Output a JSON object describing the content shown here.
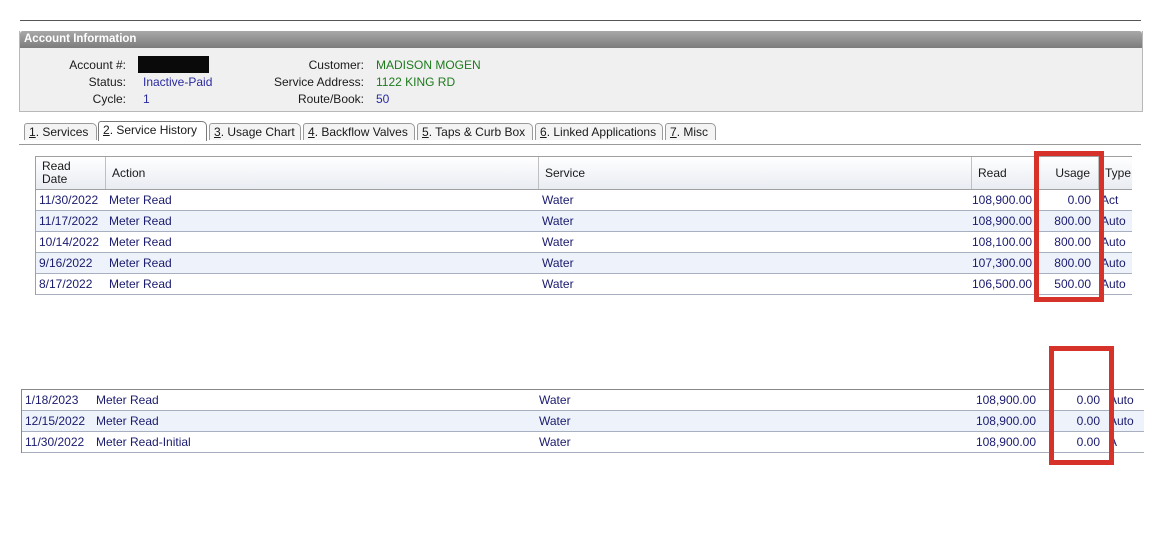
{
  "account_info": {
    "title": "Account Information",
    "account_label": "Account #:",
    "status_label": "Status:",
    "status_value": "Inactive-Paid",
    "cycle_label": "Cycle:",
    "cycle_value": "1",
    "customer_label": "Customer:",
    "customer_value": "MADISON MOGEN",
    "service_address_label": "Service Address:",
    "service_address_value": "1122 KING RD",
    "route_label": "Route/Book:",
    "route_value": "50"
  },
  "tabs": [
    {
      "key": "1",
      "label": ". Services"
    },
    {
      "key": "2",
      "label": ". Service History"
    },
    {
      "key": "3",
      "label": ". Usage Chart"
    },
    {
      "key": "4",
      "label": ". Backflow Valves"
    },
    {
      "key": "5",
      "label": ". Taps & Curb Box"
    },
    {
      "key": "6",
      "label": ". Linked Applications"
    },
    {
      "key": "7",
      "label": ". Misc"
    }
  ],
  "history": {
    "headers": {
      "read_date_1": "Read",
      "read_date_2": "Date",
      "action": "Action",
      "service": "Service",
      "read": "Read",
      "usage": "Usage",
      "type": "Type"
    },
    "rows": [
      {
        "date": "11/30/2022",
        "action": "Meter Read",
        "service": "Water",
        "read": "108,900.00",
        "usage": "0.00",
        "type": "Act"
      },
      {
        "date": "11/17/2022",
        "action": "Meter Read",
        "service": "Water",
        "read": "108,900.00",
        "usage": "800.00",
        "type": "Auto"
      },
      {
        "date": "10/14/2022",
        "action": "Meter Read",
        "service": "Water",
        "read": "108,100.00",
        "usage": "800.00",
        "type": "Auto"
      },
      {
        "date": "9/16/2022",
        "action": "Meter Read",
        "service": "Water",
        "read": "107,300.00",
        "usage": "800.00",
        "type": "Auto"
      },
      {
        "date": "8/17/2022",
        "action": "Meter Read",
        "service": "Water",
        "read": "106,500.00",
        "usage": "500.00",
        "type": "Auto"
      }
    ]
  },
  "history2": {
    "rows": [
      {
        "date": "1/18/2023",
        "action": "Meter Read",
        "service": "Water",
        "read": "108,900.00",
        "usage": "0.00",
        "type": "Auto"
      },
      {
        "date": "12/15/2022",
        "action": "Meter Read",
        "service": "Water",
        "read": "108,900.00",
        "usage": "0.00",
        "type": "Auto"
      },
      {
        "date": "11/30/2022",
        "action": "Meter Read-Initial",
        "service": "Water",
        "read": "108,900.00",
        "usage": "0.00",
        "type": "A"
      }
    ]
  },
  "colors": {
    "highlight": "#d6322a",
    "value_blue": "#2a2aa0",
    "value_green": "#1e7a1e"
  }
}
